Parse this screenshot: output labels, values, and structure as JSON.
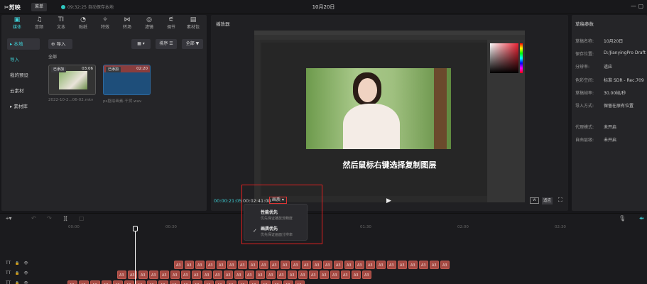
{
  "topbar": {
    "app_name": "剪映",
    "menu_label": "菜单",
    "save_status": "09:32:25 自动保存本地",
    "project_title": "10月20日",
    "window_controls": "— ▢"
  },
  "toolbar": {
    "tools": [
      {
        "label": "媒体",
        "icon": "media-icon",
        "glyph": "▣",
        "active": true
      },
      {
        "label": "音频",
        "icon": "audio-icon",
        "glyph": "♫",
        "active": false
      },
      {
        "label": "文本",
        "icon": "text-icon",
        "glyph": "TI",
        "active": false
      },
      {
        "label": "贴纸",
        "icon": "sticker-icon",
        "glyph": "◔",
        "active": false
      },
      {
        "label": "特效",
        "icon": "effects-icon",
        "glyph": "✧",
        "active": false
      },
      {
        "label": "转场",
        "icon": "transition-icon",
        "glyph": "⋈",
        "active": false
      },
      {
        "label": "滤镜",
        "icon": "filter-icon",
        "glyph": "◎",
        "active": false
      },
      {
        "label": "调节",
        "icon": "adjust-icon",
        "glyph": "⚟",
        "active": false
      },
      {
        "label": "素材包",
        "icon": "asset-pack-icon",
        "glyph": "▤",
        "active": false
      }
    ]
  },
  "sidenav": {
    "items": [
      "▸ 本地",
      "导入",
      "我的预设",
      "云素材",
      "▸ 素材库"
    ]
  },
  "media": {
    "import_label": "导入",
    "view_label": "▦ ▾",
    "sort_label": "排序 ☰",
    "filter_label": "全部 ▼",
    "all_label": "全部",
    "items": [
      {
        "badge": "已添加",
        "duration": "03:06",
        "name": "2022-10-2...06-02.mkv"
      },
      {
        "badge": "已添加",
        "duration": "02:20",
        "name": "ps抠绘画素-干货.wav"
      }
    ]
  },
  "player": {
    "title": "播放器",
    "caption": "然后鼠标右键选择复制图层",
    "current_time": "00:00:21:05",
    "total_time": "00:02:41:08",
    "quality_label": "画质 ▾",
    "play_glyph": "▶",
    "fit_label": "W",
    "ratio_label": "适应",
    "fullscreen_glyph": "⛶",
    "quality_menu": [
      {
        "title": "性能优先",
        "subtitle": "优先保证播放流畅度",
        "checked": false
      },
      {
        "title": "画质优先",
        "subtitle": "优先保证画面分辨率",
        "checked": true
      }
    ]
  },
  "draft": {
    "title": "草稿参数",
    "rows": [
      {
        "key": "草稿名称:",
        "value": "10月20日"
      },
      {
        "key": "保存位置:",
        "value": "D:/JianyingPro Draft"
      },
      {
        "key": "分辨率:",
        "value": "适应"
      },
      {
        "key": "色彩空间:",
        "value": "标准 SDR - Rec.709"
      },
      {
        "key": "草稿帧率:",
        "value": "30.00帧/秒"
      },
      {
        "key": "导入方式:",
        "value": "保留在原有位置"
      },
      {
        "key": "代理模式:",
        "value": "未开启"
      },
      {
        "key": "自由层级:",
        "value": "未开启"
      }
    ]
  },
  "timeline": {
    "ticks": [
      "00:00",
      "00:30",
      "01:00",
      "01:30",
      "02:00",
      "02:30"
    ],
    "tracks": [
      {
        "label": "TT",
        "lock": "🔒",
        "eye": "👁"
      },
      {
        "label": "TT",
        "lock": "🔒",
        "eye": "👁"
      },
      {
        "label": "TT",
        "lock": "🔒",
        "eye": "👁"
      }
    ],
    "clip_text": "A3"
  },
  "colors": {
    "accent": "#3fd2d8",
    "clip": "#a54a43",
    "highlight_frame": "#e02020"
  }
}
